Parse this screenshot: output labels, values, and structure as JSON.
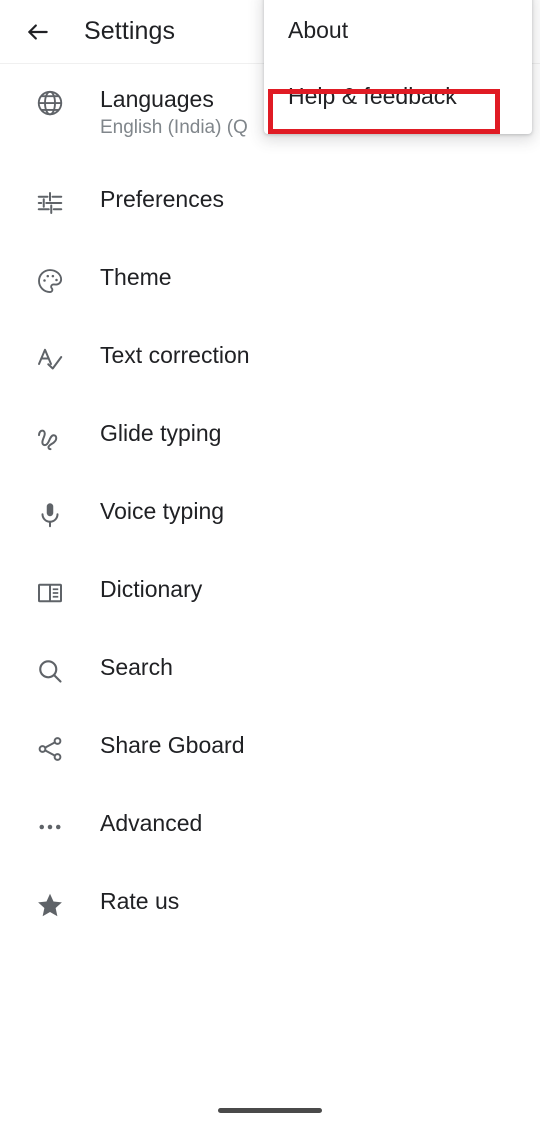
{
  "app": {
    "title": "Settings",
    "back_icon": "arrow-left-icon",
    "icon_color": "#5f6368",
    "text_color": "#202124",
    "subtitle_color": "#80868b",
    "background": "#ffffff"
  },
  "overflow_menu": {
    "visible": true,
    "items": [
      {
        "label": "About",
        "icon": "none",
        "highlighted": false
      },
      {
        "label": "Help & feedback",
        "icon": "none",
        "highlighted": true
      }
    ],
    "highlight_color": "#e01b24"
  },
  "settings_list": [
    {
      "label": "Languages",
      "subtitle": "English (India) (Q",
      "icon": "globe-icon",
      "name": "languages"
    },
    {
      "label": "Preferences",
      "subtitle": "",
      "icon": "tune-sliders-icon",
      "name": "preferences"
    },
    {
      "label": "Theme",
      "subtitle": "",
      "icon": "palette-icon",
      "name": "theme"
    },
    {
      "label": "Text correction",
      "subtitle": "",
      "icon": "spellcheck-icon",
      "name": "text-correction"
    },
    {
      "label": "Glide typing",
      "subtitle": "",
      "icon": "gesture-icon",
      "name": "glide-typing"
    },
    {
      "label": "Voice typing",
      "subtitle": "",
      "icon": "microphone-icon",
      "name": "voice-typing"
    },
    {
      "label": "Dictionary",
      "subtitle": "",
      "icon": "book-icon",
      "name": "dictionary"
    },
    {
      "label": "Search",
      "subtitle": "",
      "icon": "search-icon",
      "name": "search"
    },
    {
      "label": "Share Gboard",
      "subtitle": "",
      "icon": "share-icon",
      "name": "share-gboard"
    },
    {
      "label": "Advanced",
      "subtitle": "",
      "icon": "more-horizontal-icon",
      "name": "advanced"
    },
    {
      "label": "Rate us",
      "subtitle": "",
      "icon": "star-icon",
      "name": "rate-us"
    }
  ],
  "system": {
    "gesture_bar": true
  }
}
